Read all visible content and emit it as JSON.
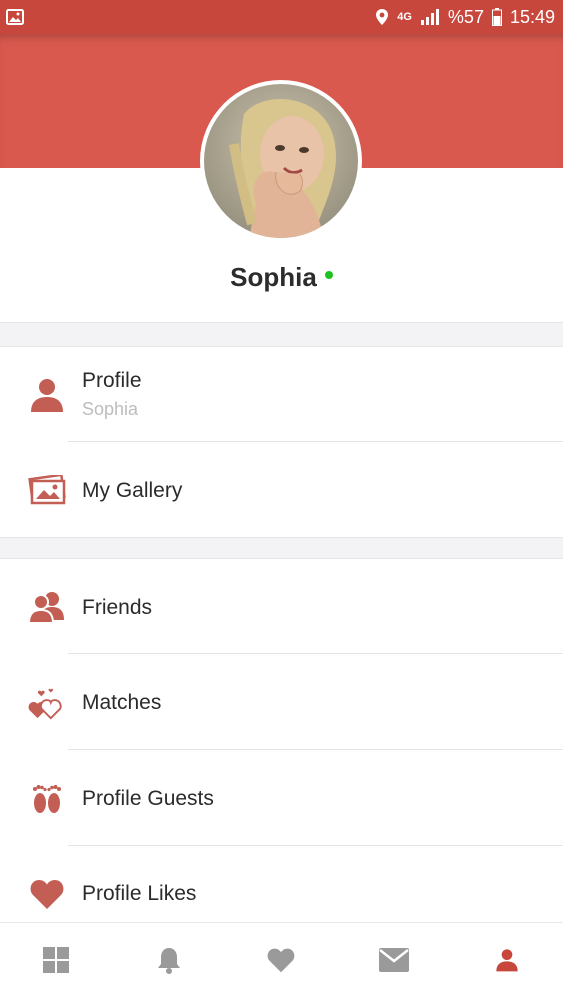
{
  "status_bar": {
    "network": "4G",
    "battery": "%57",
    "time": "15:49"
  },
  "profile": {
    "name": "Sophia",
    "online": true
  },
  "menu": [
    {
      "label": "Profile",
      "sub": "Sophia",
      "icon": "person-icon"
    },
    {
      "label": "My Gallery",
      "icon": "gallery-icon"
    },
    {
      "label": "Friends",
      "icon": "friends-icon"
    },
    {
      "label": "Matches",
      "icon": "hearts-icon"
    },
    {
      "label": "Profile Guests",
      "icon": "footprints-icon"
    },
    {
      "label": "Profile Likes",
      "icon": "heart-icon"
    }
  ],
  "bottom_nav": [
    {
      "icon": "grid-icon",
      "active": false
    },
    {
      "icon": "bell-icon",
      "active": false
    },
    {
      "icon": "heart-icon",
      "active": false
    },
    {
      "icon": "mail-icon",
      "active": false
    },
    {
      "icon": "person-icon",
      "active": true
    }
  ],
  "colors": {
    "header": "#d9594e",
    "status_bar": "#c8473c",
    "icon": "#c35e54",
    "nav_inactive": "#9a9a9a",
    "online": "#1ec21e"
  }
}
